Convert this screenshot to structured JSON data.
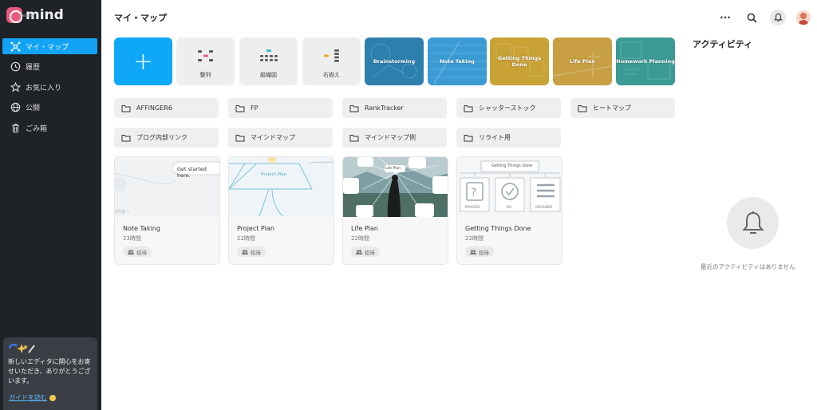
{
  "brand": {
    "name": "mind",
    "sub": "meister"
  },
  "sidebar": {
    "items": [
      {
        "label": "マイ・マップ",
        "icon": "mindmap-icon",
        "active": true
      },
      {
        "label": "履歴",
        "icon": "clock-icon"
      },
      {
        "label": "お気に入り",
        "icon": "star-icon"
      },
      {
        "label": "公開",
        "icon": "globe-icon"
      },
      {
        "label": "ごみ箱",
        "icon": "trash-icon"
      }
    ],
    "promo": {
      "text": "新しいエディタに関心をお寄せいただき、ありがとうございます。",
      "link": "ガイドを読む"
    }
  },
  "header": {
    "title": "マイ・マップ"
  },
  "toolbar": {
    "more": "···"
  },
  "templates": {
    "new_label": "+",
    "items": [
      {
        "label": "整列"
      },
      {
        "label": "組織図"
      },
      {
        "label": "右揃え"
      },
      {
        "label": "Brainstorming",
        "color": "#2d7fae"
      },
      {
        "label": "Note Taking",
        "color": "#3a9bd4"
      },
      {
        "label": "Getting Things Done",
        "color": "#c9a236"
      },
      {
        "label": "Life Plan",
        "color": "#c8a043"
      },
      {
        "label": "Homework Planning",
        "color": "#3b9b94"
      }
    ]
  },
  "folders": [
    "AFFINGER6",
    "FP",
    "RankTracker",
    "シャッターストック",
    "ヒートマップ",
    "ブログ内部リンク",
    "マインドマップ",
    "マインドマップ例",
    "リライト用"
  ],
  "maps": [
    {
      "title": "Note Taking",
      "time": "23時間",
      "badge": "招待",
      "thumb_text": "Get started here."
    },
    {
      "title": "Project Plan",
      "time": "22時間",
      "badge": "招待",
      "thumb_text": "Project Plan"
    },
    {
      "title": "Life Plan",
      "time": "22時間",
      "badge": "招待",
      "thumb_text": "Life Plan"
    },
    {
      "title": "Getting Things Done",
      "time": "22時間",
      "badge": "招待",
      "thumb_text": "Getting Things Done",
      "thumb_labels": [
        "PROCESS",
        "DO",
        "ORGANIZE"
      ]
    }
  ],
  "activity": {
    "title": "アクティビティ",
    "empty": "最近のアクティビティはありません"
  },
  "colors": {
    "accent": "#12a3f5",
    "sidebar": "#1f2226"
  }
}
